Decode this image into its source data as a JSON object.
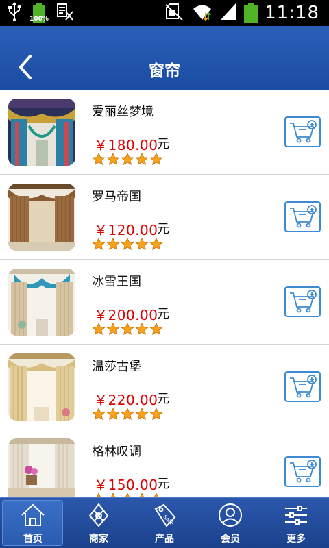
{
  "status_bar": {
    "battery_small_label": "100%",
    "time": "11:18"
  },
  "header": {
    "title": "窗帘"
  },
  "products": [
    {
      "name": "爱丽丝梦境",
      "price": "￥180.00",
      "unit": "元",
      "rating": 5
    },
    {
      "name": "罗马帝国",
      "price": "￥120.00",
      "unit": "元",
      "rating": 5
    },
    {
      "name": "冰雪王国",
      "price": "￥200.00",
      "unit": "元",
      "rating": 5
    },
    {
      "name": "温莎古堡",
      "price": "￥220.00",
      "unit": "元",
      "rating": 5
    },
    {
      "name": "格林叹调",
      "price": "￥150.00",
      "unit": "元",
      "rating": 5
    }
  ],
  "tabs": [
    {
      "label": "首页",
      "icon": "home-icon",
      "active": true
    },
    {
      "label": "商家",
      "icon": "merchant-icon",
      "active": false
    },
    {
      "label": "产品",
      "icon": "sale-tag-icon",
      "active": false
    },
    {
      "label": "会员",
      "icon": "member-icon",
      "active": false
    },
    {
      "label": "更多",
      "icon": "more-sliders-icon",
      "active": false
    }
  ],
  "colors": {
    "header_blue": "#1c4ca3",
    "price_red": "#e10000",
    "cart_blue": "#3c8bd1",
    "star_orange": "#f7a21b"
  }
}
